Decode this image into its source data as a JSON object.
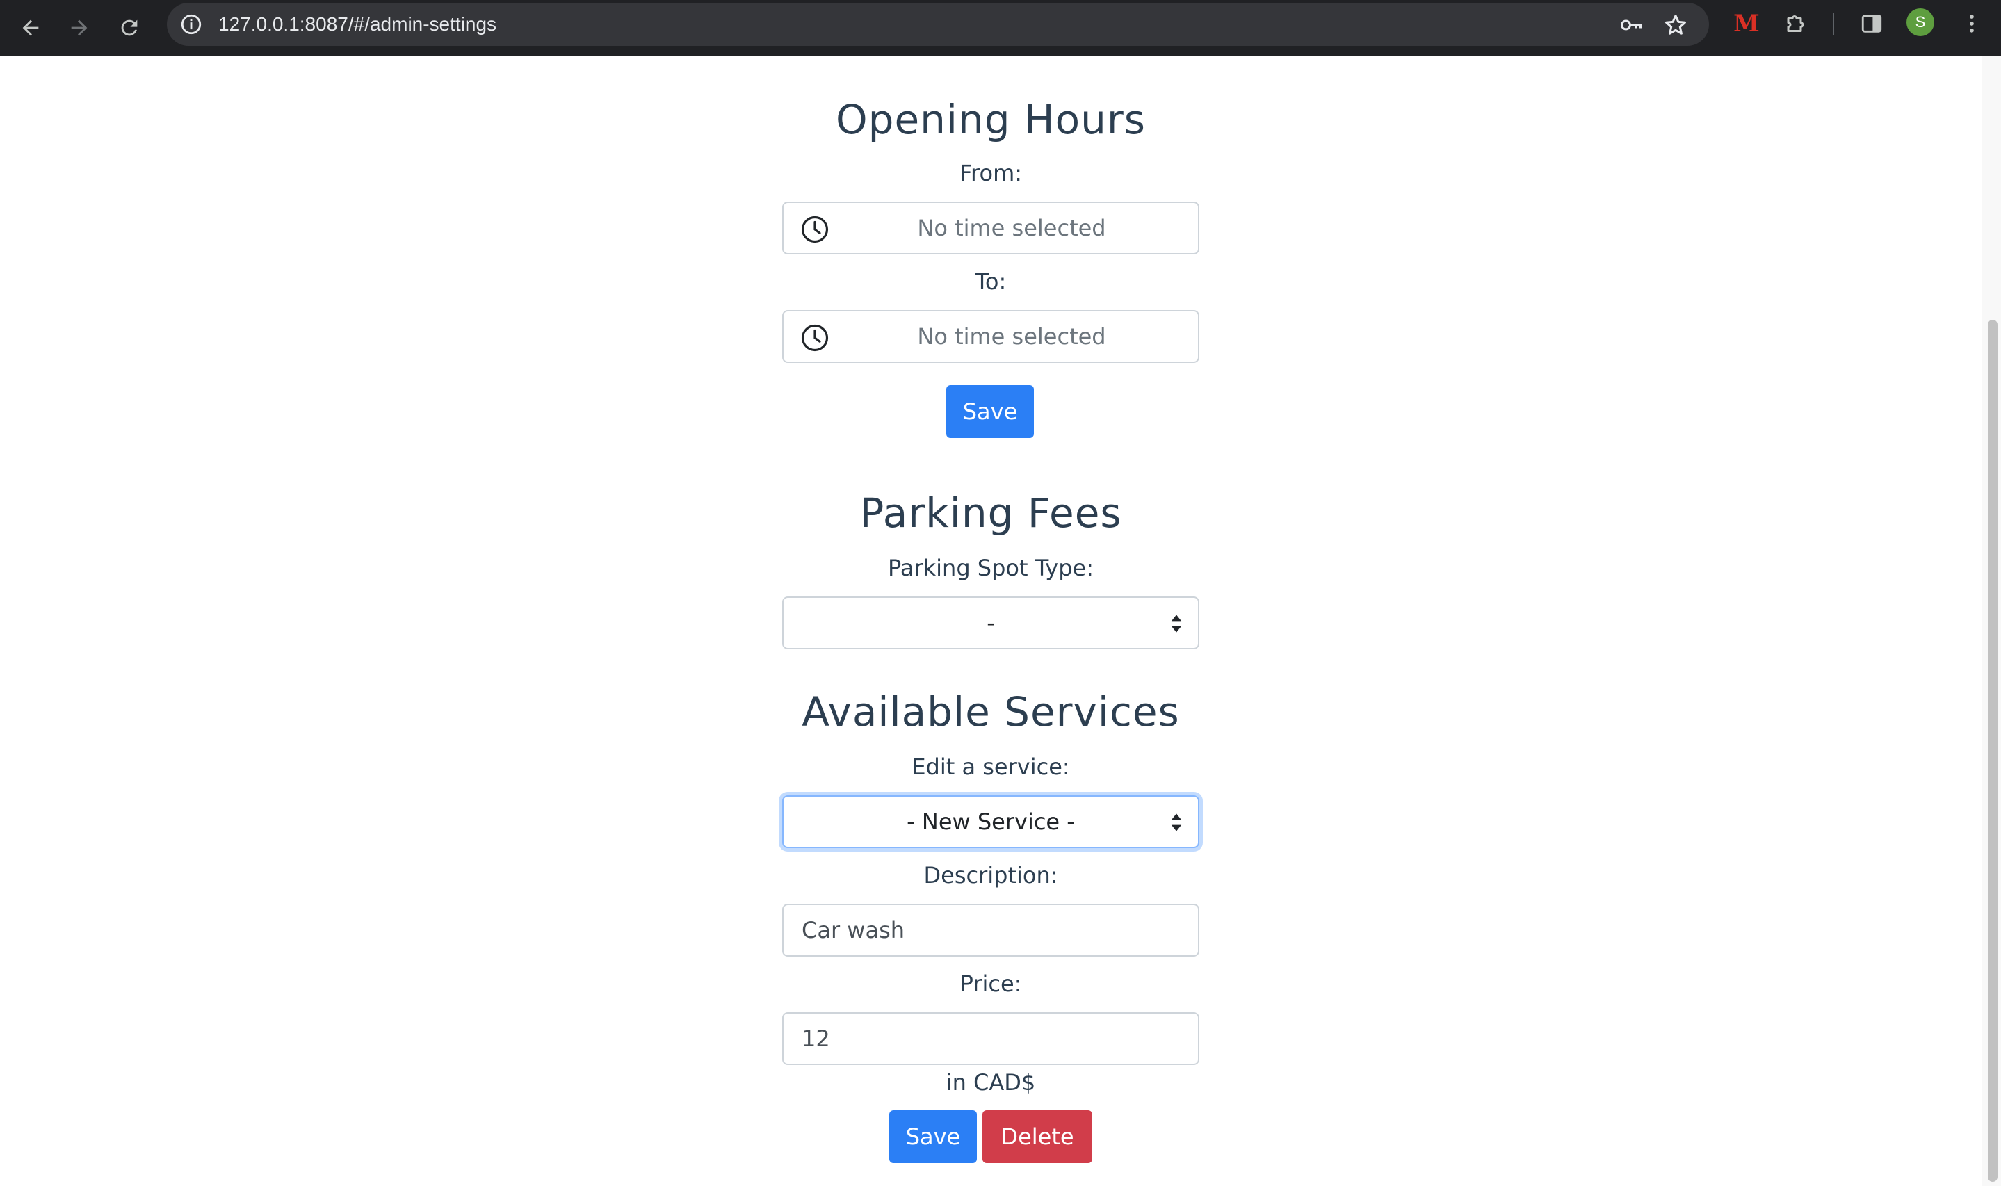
{
  "browser": {
    "url": "127.0.0.1:8087/#/admin-settings",
    "extension_letter": "M",
    "profile_initial": "S",
    "icons": [
      "back-arrow-icon",
      "forward-arrow-icon",
      "reload-icon",
      "site-info-icon",
      "key-icon",
      "star-icon",
      "extension-m-icon",
      "puzzle-icon",
      "side-panel-icon",
      "menu-dots-icon"
    ]
  },
  "opening_hours": {
    "title": "Opening Hours",
    "from_label": "From:",
    "from_placeholder": "No time selected",
    "to_label": "To:",
    "to_placeholder": "No time selected",
    "save_label": "Save"
  },
  "parking_fees": {
    "title": "Parking Fees",
    "spot_type_label": "Parking Spot Type:",
    "spot_type_value": "-"
  },
  "services": {
    "title": "Available Services",
    "edit_label": "Edit a service:",
    "edit_value": "- New Service -",
    "description_label": "Description:",
    "description_value": "Car wash",
    "price_label": "Price:",
    "price_value": "12",
    "currency_note": "in CAD$",
    "save_label": "Save",
    "delete_label": "Delete"
  },
  "colors": {
    "primary": "#2b7ff5",
    "danger": "#d13d4a",
    "heading": "#2c3e50",
    "chrome": "#202124"
  }
}
